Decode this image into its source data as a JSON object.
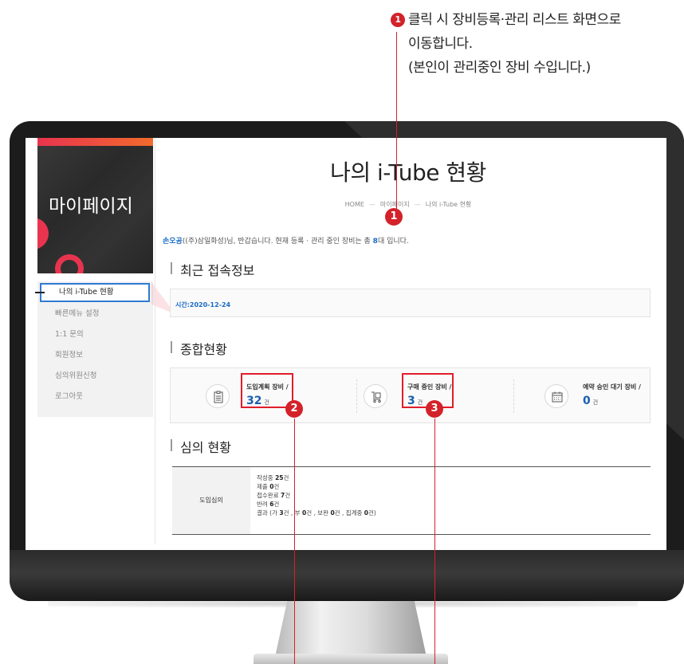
{
  "callout": {
    "number": "1",
    "line1": "클릭 시 장비등록·관리 리스트 화면으로",
    "line2": "이동합니다.",
    "line3": "(본인이 관리중인 장비 수입니다.)"
  },
  "sidebar": {
    "title": "마이페이지",
    "items": [
      {
        "label": "나의 i-Tube 현황",
        "active": true
      },
      {
        "label": "빠른메뉴 설정"
      },
      {
        "label": "1:1 문의"
      },
      {
        "label": "회원정보"
      },
      {
        "label": "심의위원신청"
      },
      {
        "label": "로그아웃"
      }
    ]
  },
  "page": {
    "title": "나의 i-Tube 현황",
    "breadcrumb": [
      "HOME",
      "마이페이지",
      "나의 i-Tube 현황"
    ]
  },
  "greeting": {
    "name": "손오공",
    "text_before": "((주)삼일화성)님, 반갑습니다. 현재 등록 · 관리 중인 장비는 총 ",
    "count": "8",
    "text_after": "대 입니다."
  },
  "recent": {
    "title": "최근 접속정보",
    "time": "시간:2020-12-24"
  },
  "summary": {
    "title": "종합현황",
    "stats": [
      {
        "label": "도입계획 장비 /",
        "value": "32",
        "unit": "건",
        "icon": "clipboard-icon"
      },
      {
        "label": "구매 중인 장비 /",
        "value": "3",
        "unit": "건",
        "icon": "cart-icon"
      },
      {
        "label": "예약 승인 대기 장비 /",
        "value": "0",
        "unit": "건",
        "icon": "calendar-icon"
      }
    ]
  },
  "review": {
    "title": "심의 현황",
    "header": "도입심의",
    "lines": {
      "writing_label": "작성중 ",
      "writing_value": "25",
      "writing_unit": "건",
      "submitted_label": "제출 ",
      "submitted_value": "0",
      "submitted_unit": "건",
      "received_label": "접수완료 ",
      "received_value": "7",
      "received_unit": "건",
      "rejected_label": "반려 ",
      "rejected_value": "6",
      "rejected_unit": "건",
      "result_label": "결과 (가 ",
      "result_yes": "3",
      "result_sep1": "건 , 부 ",
      "result_no": "0",
      "result_sep2": "건 , 보완 ",
      "result_supp": "0",
      "result_sep3": "건 , 집계중 ",
      "result_pending": "0",
      "result_end": "건)"
    }
  },
  "markers": [
    "1",
    "2",
    "3"
  ],
  "colors": {
    "accent_red": "#d3222a",
    "link_blue": "#1a6bc5",
    "active_border": "#2f7ad2",
    "brand_gradient_start": "#e8344f",
    "brand_gradient_end": "#f26a2d"
  }
}
